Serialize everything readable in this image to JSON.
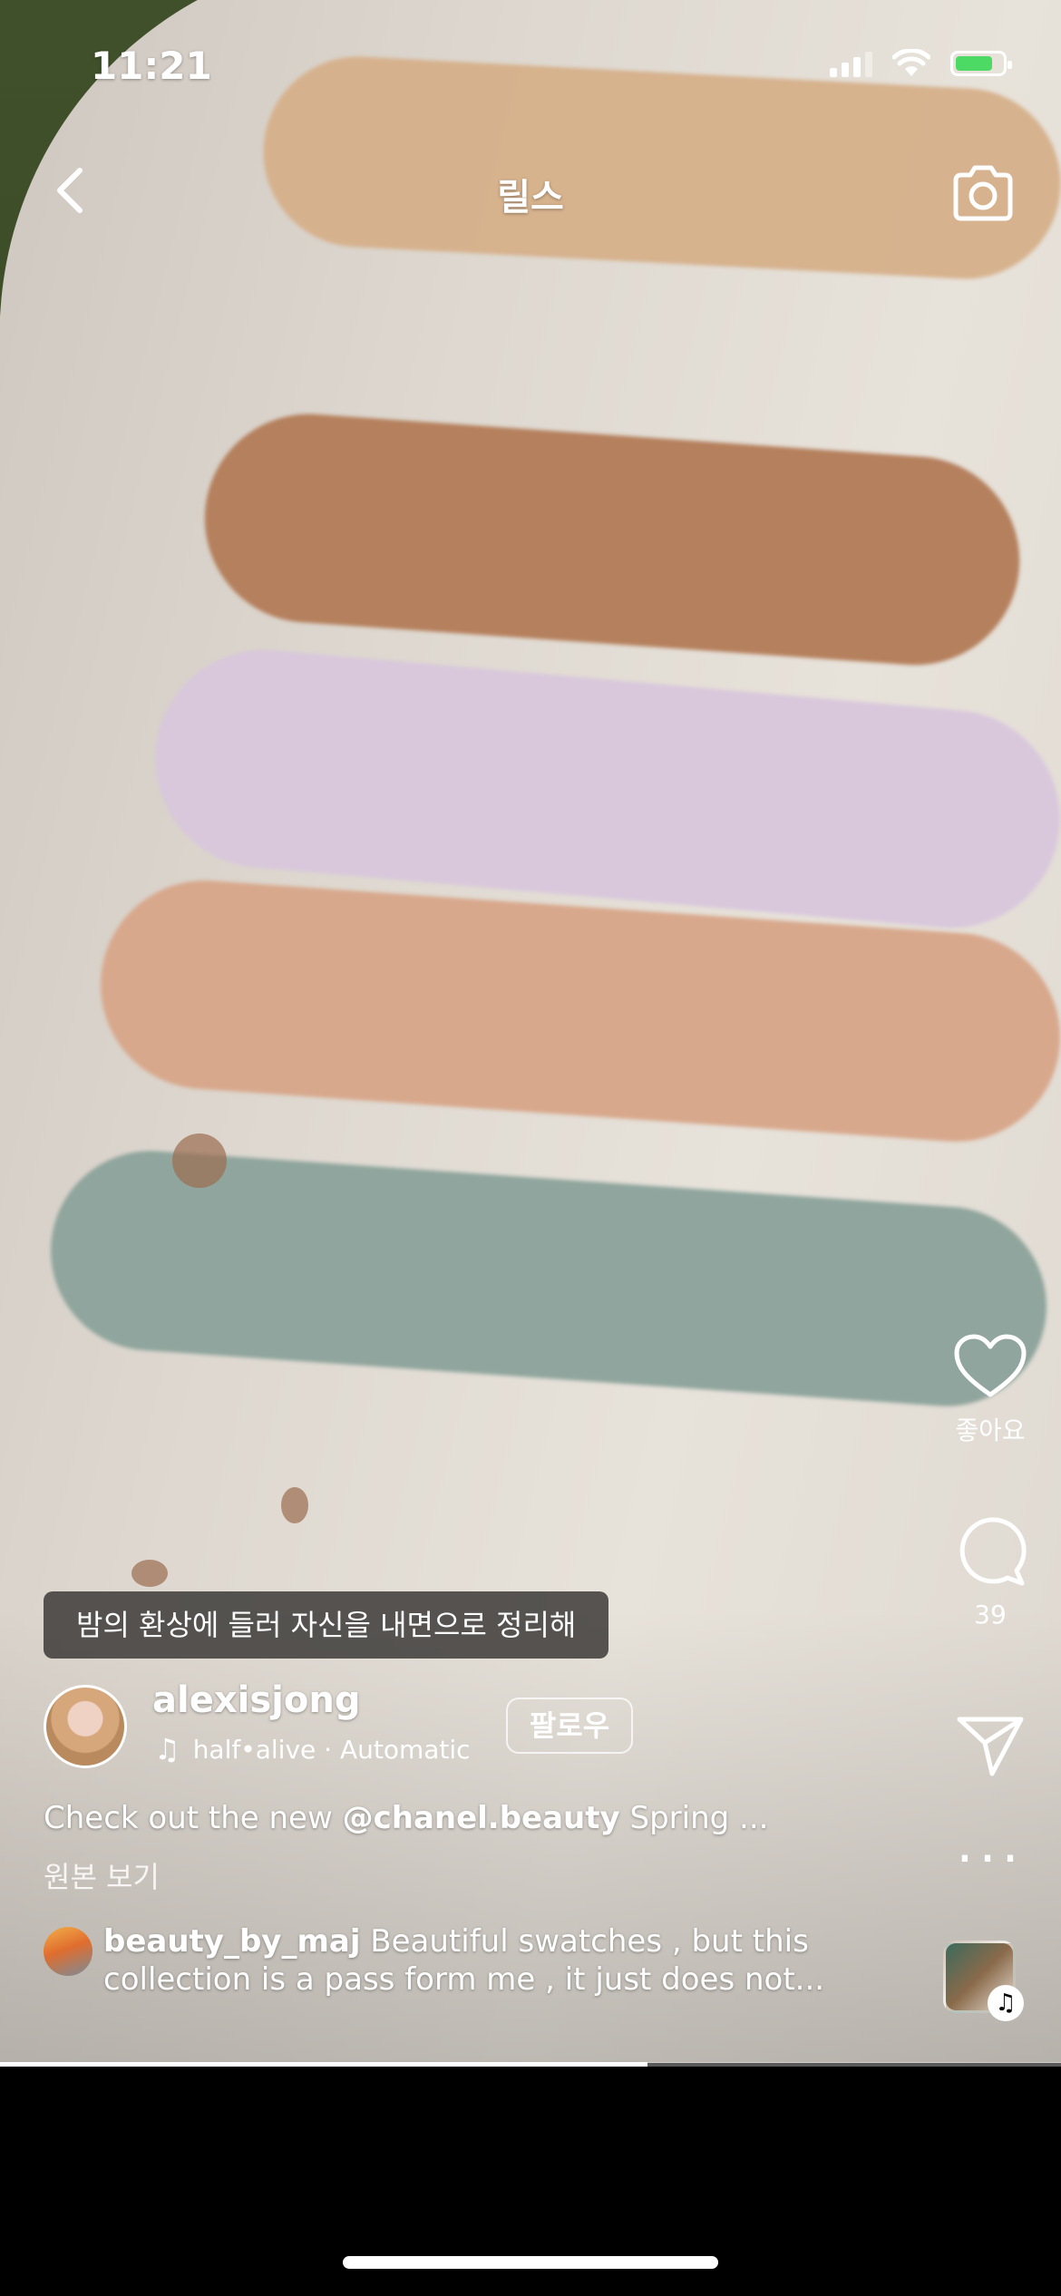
{
  "status_bar": {
    "time": "11:21"
  },
  "header": {
    "title": "릴스"
  },
  "subtitle": "밤의 환상에 들러 자신을 내면으로 정리해",
  "author": {
    "username": "alexisjong",
    "follow_label": "팔로우"
  },
  "audio": {
    "track": "half•alive · Automatic"
  },
  "caption": {
    "prefix": "Check out the new ",
    "mention": "@chanel.beauty",
    "suffix": " Spring ..."
  },
  "view_original_label": "원본 보기",
  "top_comment": {
    "username": "beauty_by_maj",
    "text": " Beautiful swatches , but this collection is a pass form me , it just does not..."
  },
  "actions": {
    "like_label": "좋아요",
    "comment_count": "39"
  },
  "playback": {
    "progress_fraction": 0.61
  },
  "colors": {
    "accent": "#ffffff",
    "battery": "#4cd964"
  }
}
